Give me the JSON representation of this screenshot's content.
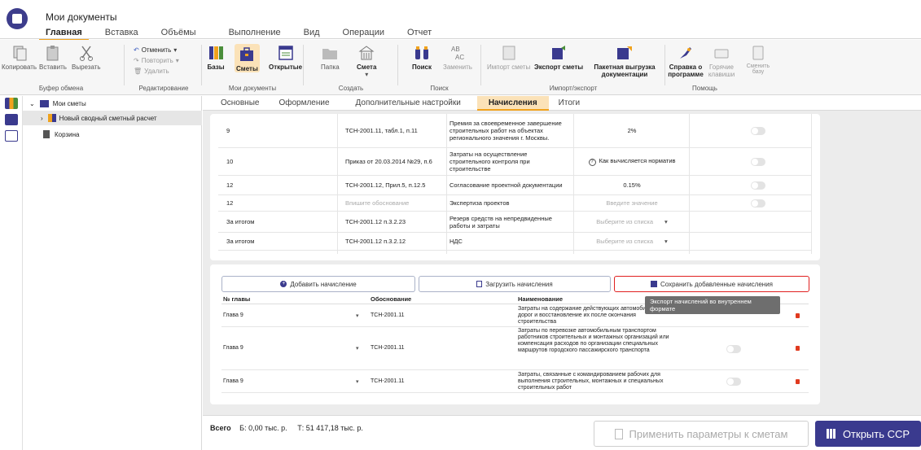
{
  "window": {
    "title": "Мои документы"
  },
  "menu_tabs": [
    "Главная",
    "Вставка",
    "Объёмы",
    "Выполнение",
    "Вид",
    "Операции",
    "Отчет"
  ],
  "ribbon": {
    "clipboard": {
      "copy": "Копировать",
      "paste": "Вставить",
      "cut": "Вырезать",
      "label": "Буфер обмена"
    },
    "edit": {
      "undo": "Отменить",
      "redo": "Повторить",
      "delete": "Удалить",
      "label": "Редактирование"
    },
    "mydocs": {
      "bases": "Базы",
      "estimates": "Сметы",
      "open": "Открытые",
      "label": "Мои документы"
    },
    "create": {
      "folder": "Папка",
      "estimate": "Смета",
      "label": "Создать"
    },
    "search": {
      "find": "Поиск",
      "replace": "Заменить",
      "label": "Поиск"
    },
    "io": {
      "import": "Импорт сметы",
      "export": "Экспорт сметы",
      "batch": "Пакетная выгрузка документации",
      "label": "Импорт/экспорт"
    },
    "help": {
      "ref": "Справка о программе",
      "hotkeys": "Горячие клавиши",
      "change": "Сменить базу",
      "label": "Помощь"
    }
  },
  "tree": {
    "root": "Мои сметы",
    "item": "Новый сводный сметный расчет",
    "trash": "Корзина"
  },
  "subtabs": [
    "Основные",
    "Оформление",
    "Дополнительные настройки",
    "Начисления",
    "Итоги"
  ],
  "accruals": [
    {
      "chapter": "9",
      "basis": "ТСН-2001.11, табл.1, п.11",
      "name": "Премия за своевременное завершение строительных работ на объектах регионального значения г. Москвы.",
      "value": "2%"
    },
    {
      "chapter": "10",
      "basis": "Приказ от 20.03.2014 №29, п.6",
      "name": "Затраты на осуществление строительного контроля при строительстве",
      "value": "Как вычисляется норматив"
    },
    {
      "chapter": "12",
      "basis": "ТСН-2001.12, Прил.5, п.12.5",
      "name": "Согласование проектной документации",
      "value": "0.15%"
    },
    {
      "chapter": "12",
      "basis": "Впишите обоснование",
      "name": "Экспертиза проектов",
      "value": "Введите значение"
    },
    {
      "chapter": "За итогом",
      "basis": "ТСН-2001.12 п.3.2.23",
      "name": "Резерв средств на непредвиденные работы и затраты",
      "value": "Выберите из списка"
    },
    {
      "chapter": "За итогом",
      "basis": "ТСН-2001.12 п.3.2.12",
      "name": "НДС",
      "value": "Выберите из списка"
    }
  ],
  "actions": {
    "add": "Добавить начисление",
    "load": "Загрузить начисления",
    "save": "Сохранить добавленные начисления"
  },
  "tooltip": "Экспорт начислений во внутреннем формате",
  "added_header": {
    "chapter": "№ главы",
    "basis": "Обоснование",
    "name": "Наименование"
  },
  "added": [
    {
      "chapter": "Глава 9",
      "basis": "ТСН-2001.11",
      "name": "Затраты на содержание действующих автомобильных дорог и восстановление их после окончания строительства"
    },
    {
      "chapter": "Глава 9",
      "basis": "ТСН-2001.11",
      "name": "Затраты по перевозке автомобильным транспортом работников строительных и монтажных организаций или компенсация расходов по организации специальных маршрутов городского пассажирского транспорта"
    },
    {
      "chapter": "Глава 9",
      "basis": "ТСН-2001.11",
      "name": "Затраты, связанные с командированием рабочих для выполнения строительных, монтажных и специальных строительных работ"
    }
  ],
  "footer": {
    "total_label": "Всего",
    "b": "Б: 0,00 тыс. р.",
    "t": "Т: 51 417,18 тыс. р.",
    "apply": "Применить параметры к сметам",
    "open": "Открыть ССР"
  }
}
